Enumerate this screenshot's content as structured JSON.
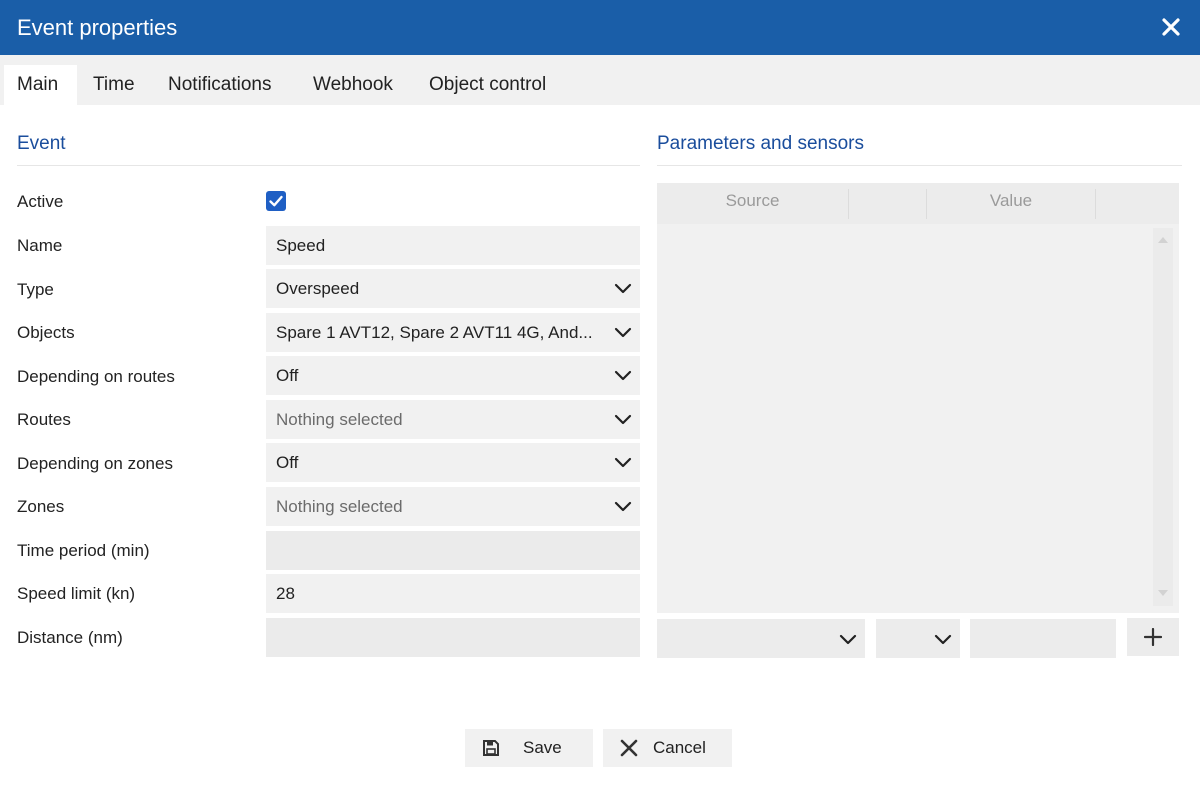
{
  "dialog": {
    "title": "Event properties"
  },
  "tabs": [
    "Main",
    "Time",
    "Notifications",
    "Webhook",
    "Object control"
  ],
  "event_section": {
    "title": "Event",
    "active_label": "Active",
    "active_checked": true,
    "fields": [
      {
        "label": "Name",
        "value": "Speed",
        "kind": "text"
      },
      {
        "label": "Type",
        "value": "Overspeed",
        "kind": "select"
      },
      {
        "label": "Objects",
        "value": "Spare 1 AVT12, Spare 2 AVT11 4G, And...",
        "kind": "select"
      },
      {
        "label": "Depending on routes",
        "value": "Off",
        "kind": "select"
      },
      {
        "label": "Routes",
        "value": "Nothing selected",
        "kind": "select",
        "placeholder": true
      },
      {
        "label": "Depending on zones",
        "value": "Off",
        "kind": "select"
      },
      {
        "label": "Zones",
        "value": "Nothing selected",
        "kind": "select",
        "placeholder": true
      },
      {
        "label": "Time period (min)",
        "value": "",
        "kind": "text"
      },
      {
        "label": "Speed limit (kn)",
        "value": "28",
        "kind": "text"
      },
      {
        "label": "Distance (nm)",
        "value": "",
        "kind": "text"
      }
    ]
  },
  "params_section": {
    "title": "Parameters and sensors",
    "columns": [
      "Source",
      "",
      "Value",
      ""
    ],
    "rows": [],
    "source_select_value": "",
    "condition_select_value": "",
    "value_input": ""
  },
  "footer": {
    "save_label": "Save",
    "cancel_label": "Cancel"
  },
  "colors": {
    "titlebar": "#1a5ea8",
    "accent_text": "#1a4d9c",
    "checkbox": "#1f5fc4"
  },
  "icons": {
    "close": "close-icon",
    "chevron": "chevron-down-icon",
    "add": "plus-icon",
    "save": "floppy-disk-icon",
    "cancel": "x-icon"
  }
}
